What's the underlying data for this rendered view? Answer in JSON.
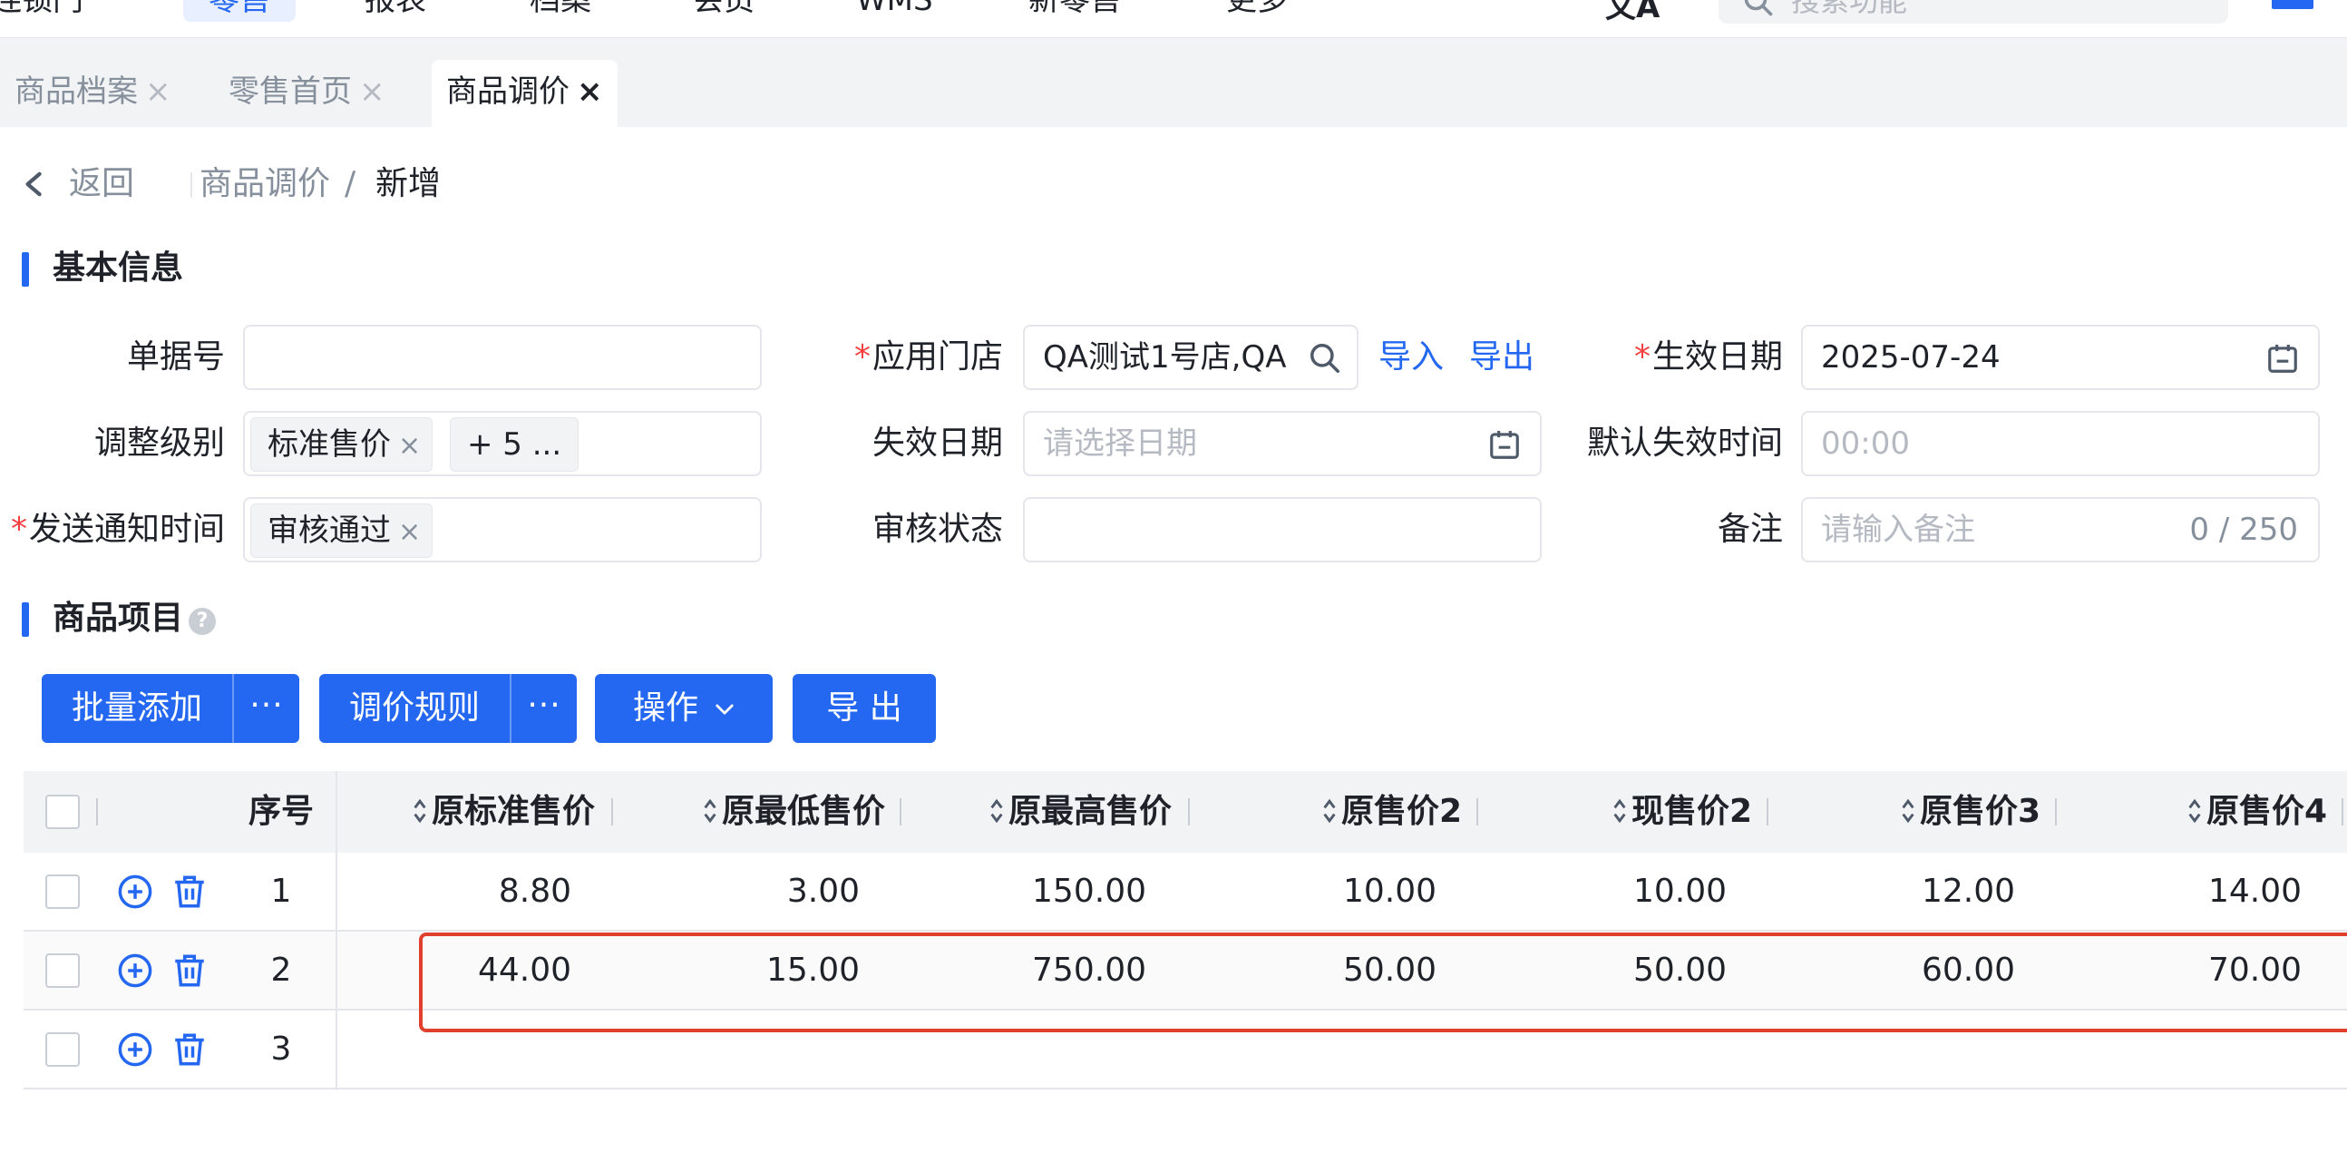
{
  "topnav": {
    "items": [
      {
        "label": "连锁门"
      },
      {
        "label": "零售"
      },
      {
        "label": "报表"
      },
      {
        "label": "档案"
      },
      {
        "label": "会员"
      },
      {
        "label": "WMS"
      },
      {
        "label": "新零售"
      },
      {
        "label": "更多"
      }
    ],
    "search_placeholder": "搜索功能",
    "accent": "#2468f2"
  },
  "tabs": [
    {
      "label": "商品档案",
      "active": false
    },
    {
      "label": "零售首页",
      "active": false
    },
    {
      "label": "商品调价",
      "active": true
    }
  ],
  "tab_close_glyph": "×",
  "breadcrumb": {
    "back_label": "返回",
    "parent": "商品调价",
    "separator": "/",
    "current": "新增"
  },
  "sections": {
    "basic_info": "基本信息",
    "items": "商品项目",
    "help_glyph": "?"
  },
  "form": {
    "required_mark": "*",
    "doc_no": {
      "label": "单据号",
      "value": ""
    },
    "adjust_level": {
      "label": "调整级别",
      "tag": "标准售价",
      "more_tag": "+ 5 ..."
    },
    "notify_time": {
      "label": "发送通知时间",
      "required": true,
      "tag": "审核通过"
    },
    "store": {
      "label": "应用门店",
      "required": true,
      "value": "QA测试1号店,QA",
      "import_label": "导入",
      "export_label": "导出"
    },
    "expire_date": {
      "label": "失效日期",
      "placeholder": "请选择日期"
    },
    "audit_status": {
      "label": "审核状态",
      "value": ""
    },
    "effective_date": {
      "label": "生效日期",
      "required": true,
      "value": "2025-07-24"
    },
    "default_expire_time": {
      "label": "默认失效时间",
      "placeholder": "00:00"
    },
    "remark": {
      "label": "备注",
      "placeholder": "请输入备注",
      "counter": "0 / 250"
    },
    "tag_close_glyph": "×"
  },
  "toolbar": {
    "batch_add": "批量添加",
    "more_glyph": "···",
    "price_rule": "调价规则",
    "operation": "操作",
    "export": "导 出"
  },
  "table": {
    "columns": [
      "序号",
      "原标准售价",
      "原最低售价",
      "原最高售价",
      "原售价2",
      "现售价2",
      "原售价3",
      "原售价4"
    ],
    "rows": [
      {
        "idx": "1",
        "cells": [
          "8.80",
          "3.00",
          "150.00",
          "10.00",
          "10.00",
          "12.00",
          "14.00"
        ]
      },
      {
        "idx": "2",
        "cells": [
          "44.00",
          "15.00",
          "750.00",
          "50.00",
          "50.00",
          "60.00",
          "70.00"
        ]
      },
      {
        "idx": "3",
        "cells": [
          "",
          "",
          "",
          "",
          "",
          "",
          ""
        ]
      }
    ],
    "highlighted_row": "2"
  },
  "colors": {
    "primary": "#2468f2",
    "required": "#f53f3f",
    "highlight_border": "#e0402e"
  }
}
